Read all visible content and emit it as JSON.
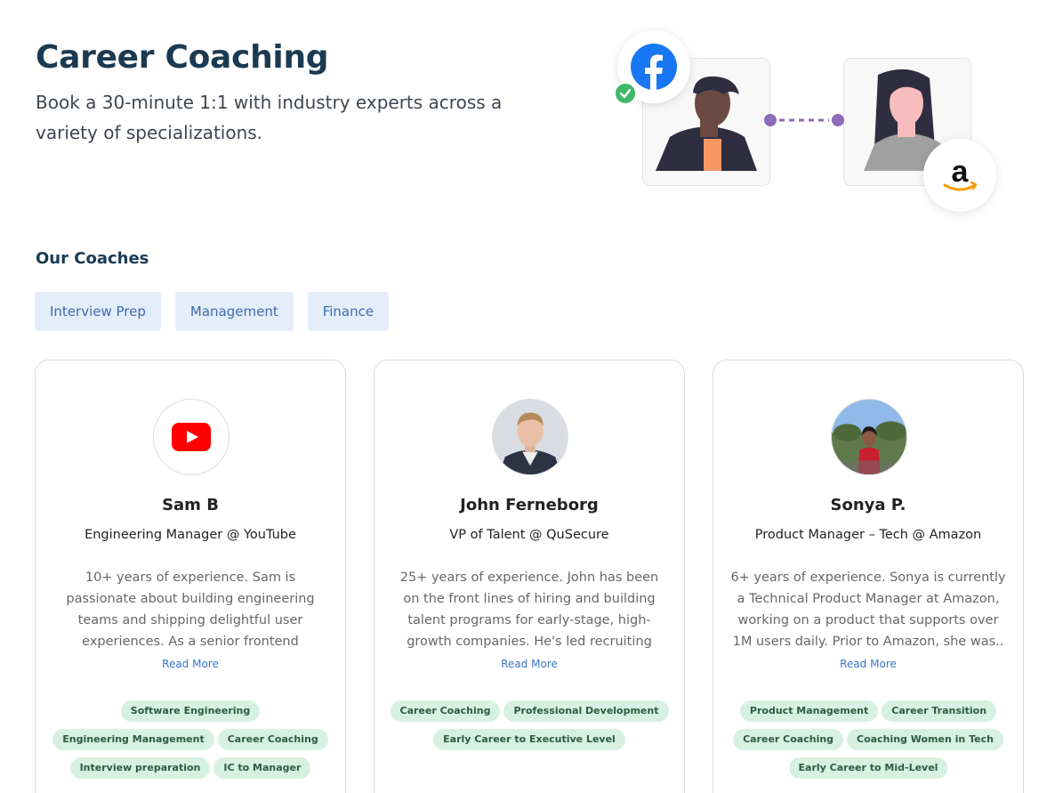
{
  "hero": {
    "title": "Career Coaching",
    "subtitle": "Book a 30-minute 1:1 with industry experts across a variety of specializations."
  },
  "illustration": {
    "left_logo": "facebook-icon",
    "right_logo": "amazon-icon",
    "accent": "#8c6bb8"
  },
  "coaches_section": {
    "title": "Our Coaches",
    "filters": [
      "Interview Prep",
      "Management",
      "Finance"
    ]
  },
  "coaches": [
    {
      "avatar": "youtube-icon",
      "name": "Sam B",
      "role": "Engineering Manager @ YouTube",
      "bio": "10+ years of experience. Sam is passionate about building engineering teams and shipping delightful user experiences. As a senior frontend engineer at multiple early..",
      "read_more": "Read More",
      "tags": [
        "Software Engineering",
        "Engineering Management",
        "Career Coaching",
        "Interview preparation",
        "IC to Manager"
      ]
    },
    {
      "avatar": "profile-photo",
      "name": "John Ferneborg",
      "role": "VP of Talent @ QuSecure",
      "bio": "25+ years of experience. John has been on the front lines of hiring and building talent programs for early-stage, high-growth companies. He's led recruiting teams at ...",
      "read_more": "Read More",
      "tags": [
        "Career Coaching",
        "Professional Development",
        "Early Career to Executive Level"
      ]
    },
    {
      "avatar": "profile-photo",
      "name": "Sonya P.",
      "role": "Product Manager – Tech @ Amazon",
      "bio": "6+ years of experience. Sonya is currently a Technical Product Manager at Amazon, working on a product that supports over 1M users daily. Prior to Amazon, she was..",
      "read_more": "Read More",
      "tags": [
        "Product Management",
        "Career Transition",
        "Career Coaching",
        "Coaching Women in Tech",
        "Early Career to Mid-Level"
      ]
    }
  ],
  "colors": {
    "title": "#1b3a52",
    "filter_bg": "#e4eefb",
    "tag_bg": "#d6f1e1",
    "link": "#3a77c8"
  }
}
